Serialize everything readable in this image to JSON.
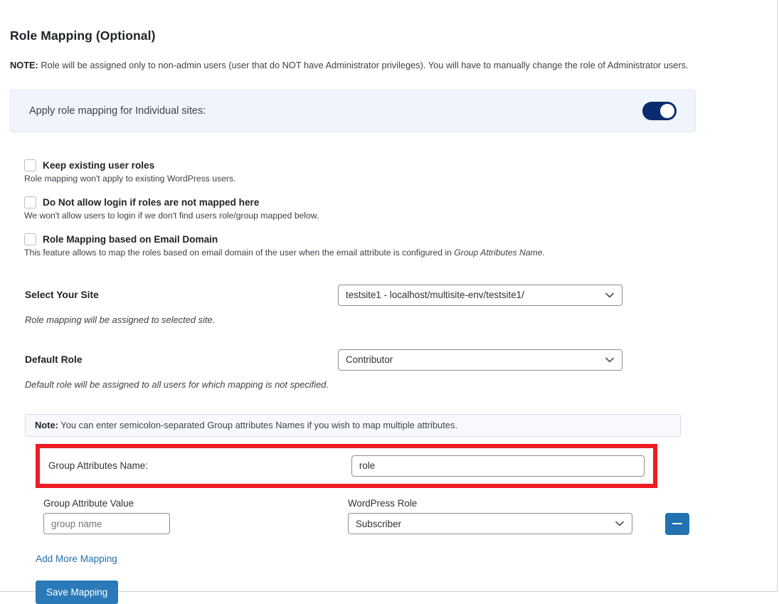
{
  "section": {
    "title": "Role Mapping (Optional)",
    "note_prefix": "NOTE:",
    "note_text": " Role will be assigned only to non-admin users (user that do NOT have Administrator privileges). You will have to manually change the role of Administrator users."
  },
  "toggle_panel": {
    "label": "Apply role mapping for Individual sites:",
    "state": "on",
    "on_color": "#0a2c6e"
  },
  "checkboxes": [
    {
      "label": "Keep existing user roles",
      "checked": false,
      "description": "Role mapping won't apply to existing WordPress users.",
      "description_italic": ""
    },
    {
      "label": "Do Not allow login if roles are not mapped here",
      "checked": false,
      "description": "We won't allow users to login if we don't find users role/group mapped below.",
      "description_italic": ""
    },
    {
      "label": "Role Mapping based on Email Domain",
      "checked": false,
      "description": "This feature allows to map the roles based on email domain of the user when the email attribute is configured in ",
      "description_italic": "Group Attributes Name.",
      "description_tail": ""
    }
  ],
  "select_site": {
    "label": "Select Your Site",
    "value": "testsite1  - localhost/multisite-env/testsite1/",
    "description": "Role mapping will be assigned to selected site."
  },
  "default_role": {
    "label": "Default Role",
    "value": "Contributor",
    "description": "Default role will be assigned to all users for which mapping is not specified."
  },
  "info_note": {
    "prefix": "Note:",
    "text": " You can enter semicolon-separated Group attributes Names if you wish to map multiple attributes."
  },
  "group_attributes": {
    "label": "Group Attributes Name:",
    "value": "role",
    "highlight_color": "#ee1c24"
  },
  "mapping": {
    "value_header": "Group Attribute Value",
    "role_header": "WordPress Role",
    "value_placeholder": "group name",
    "value_current": "",
    "role_value": "Subscriber",
    "remove_label": "remove-mapping"
  },
  "actions": {
    "add_more": "Add More Mapping",
    "save": "Save Mapping",
    "save_color": "#2a7ab9"
  }
}
